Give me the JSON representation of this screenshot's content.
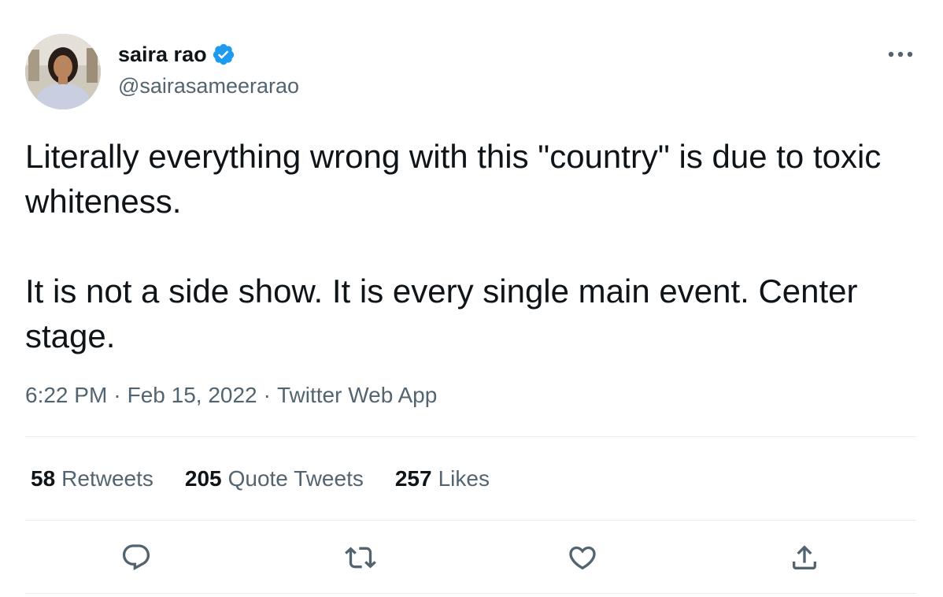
{
  "author": {
    "display_name": "saira rao",
    "handle": "@sairasameerarao",
    "verified": true
  },
  "tweet": {
    "text": "Literally everything wrong with this \"country\" is due to toxic whiteness.\n\nIt is not a side show. It is every single main event. Center stage.",
    "time": "6:22 PM",
    "date": "Feb 15, 2022",
    "source": "Twitter Web App",
    "separator": "·"
  },
  "stats": {
    "retweets_count": "58",
    "retweets_label": "Retweets",
    "quotes_count": "205",
    "quotes_label": "Quote Tweets",
    "likes_count": "257",
    "likes_label": "Likes"
  },
  "icons": {
    "more": "more-horizontal-icon",
    "reply": "reply-icon",
    "retweet": "retweet-icon",
    "like": "heart-icon",
    "share": "share-icon",
    "verified": "verified-badge-icon"
  },
  "colors": {
    "text_primary": "#0f1419",
    "text_secondary": "#536471",
    "verified_blue": "#1d9bf0",
    "divider": "#e6ecf0"
  }
}
